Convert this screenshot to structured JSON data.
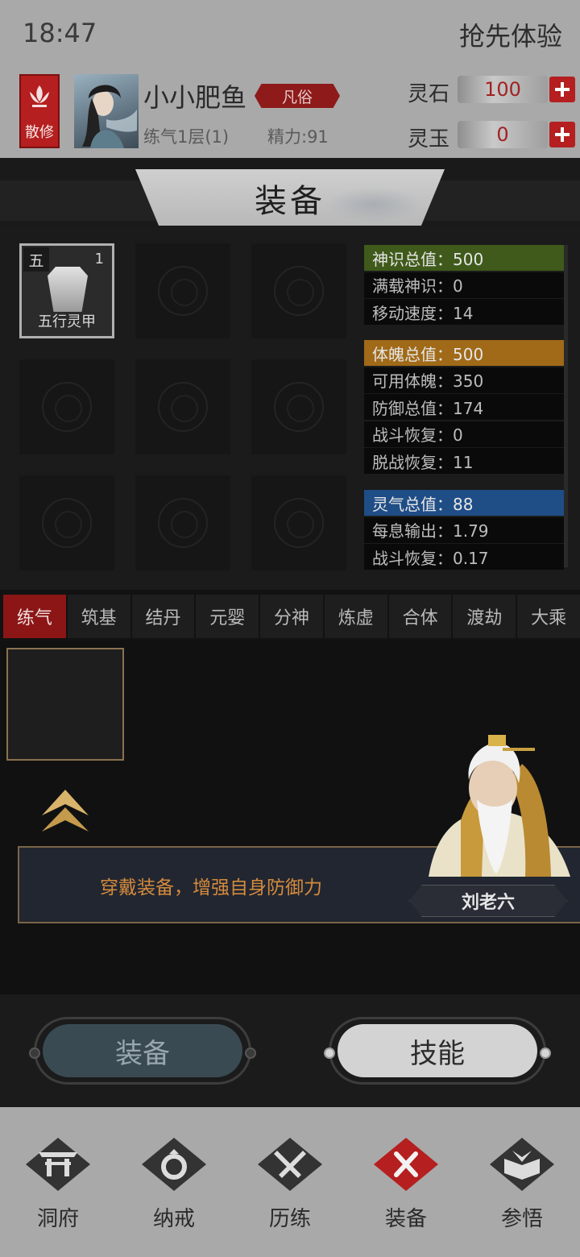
{
  "status": {
    "time": "18:47",
    "action": "抢先体验"
  },
  "player": {
    "sect": "散修",
    "name": "小小肥鱼",
    "rank": "凡俗",
    "level": "练气1层(1)",
    "energy": "精力:91"
  },
  "currency": [
    {
      "label": "灵石",
      "value": "100"
    },
    {
      "label": "灵玉",
      "value": "0"
    }
  ],
  "equipment": {
    "title": "装备",
    "slots": [
      {
        "grade": "五",
        "count": "1",
        "name": "五行灵甲"
      }
    ]
  },
  "stats": {
    "groups": [
      {
        "color": "#3f5a1a",
        "rows": [
          "神识总值：500",
          "满载神识：0",
          "移动速度：14"
        ]
      },
      {
        "color": "#a06a18",
        "rows": [
          "体魄总值：500",
          "可用体魄：350",
          "防御总值：174",
          "战斗恢复：0",
          "脱战恢复：11"
        ]
      },
      {
        "color": "#1f4d86",
        "rows": [
          "灵气总值：88",
          "每息输出：1.79",
          "战斗恢复：0.17"
        ]
      }
    ]
  },
  "tabs": [
    "练气",
    "筑基",
    "结丹",
    "元婴",
    "分神",
    "炼虚",
    "合体",
    "渡劫",
    "大乘"
  ],
  "dialog": {
    "text": "穿戴装备，增强自身防御力",
    "npc": "刘老六"
  },
  "buttons": {
    "equip": "装备",
    "skill": "技能"
  },
  "nav": [
    {
      "label": "洞府",
      "icon": "gate-icon"
    },
    {
      "label": "纳戒",
      "icon": "ring-icon"
    },
    {
      "label": "历练",
      "icon": "crossed-swords-icon"
    },
    {
      "label": "装备",
      "icon": "close-x-icon"
    },
    {
      "label": "参悟",
      "icon": "open-book-icon"
    }
  ]
}
